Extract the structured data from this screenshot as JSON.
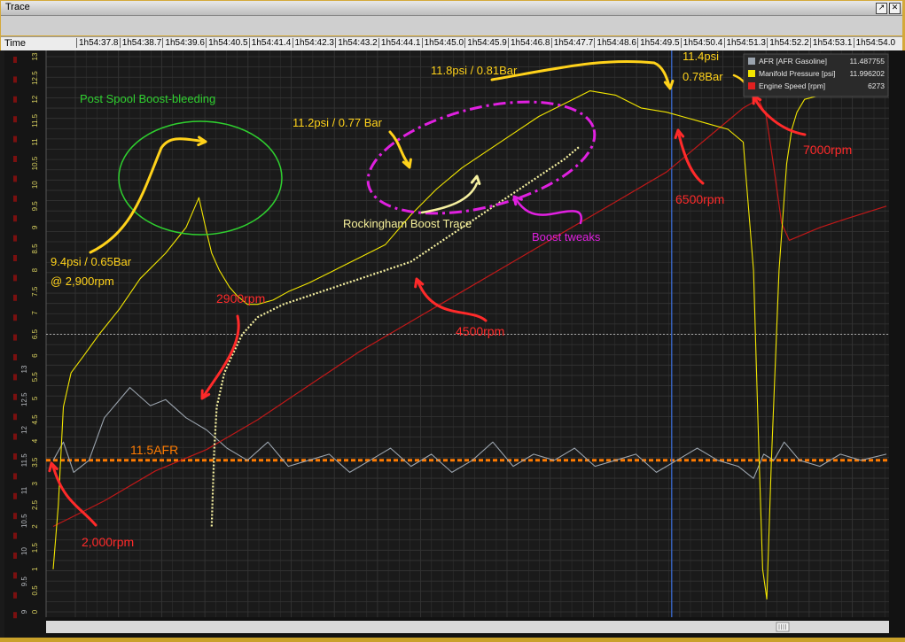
{
  "window": {
    "title": "Trace",
    "time_column_label": "Time"
  },
  "time_ticks": [
    "1h54:37.8",
    "1h54:38.7",
    "1h54:39.6",
    "1h54:40.5",
    "1h54:41.4",
    "1h54:42.3",
    "1h54:43.2",
    "1h54:44.1",
    "1h54:45.0",
    "1h54:45.9",
    "1h54:46.8",
    "1h54:47.7",
    "1h54:48.6",
    "1h54:49.5",
    "1h54:50.4",
    "1h54:51.3",
    "1h54:52.2",
    "1h54:53.1",
    "1h54:54.0"
  ],
  "legend": [
    {
      "label": "AFR [AFR Gasoline]",
      "value": "11.487755",
      "color": "#9aa3ad"
    },
    {
      "label": "Manifold Pressure [psi]",
      "value": "11.996202",
      "color": "#f2e600"
    },
    {
      "label": "Engine Speed [rpm]",
      "value": "6273",
      "color": "#e02020"
    }
  ],
  "annotations": {
    "post_spool": "Post Spool Boost-bleeding",
    "psi_94": "9.4psi / 0.65Bar",
    "at_2900": "@ 2,900rpm",
    "psi_112": "11.2psi / 0.77 Bar",
    "psi_118": "11.8psi / 0.81Bar",
    "psi_114_a": "11.4psi",
    "psi_114_b": "0.78Bar",
    "rockingham": "Rockingham Boost Trace",
    "boost_tweaks": "Boost tweaks",
    "rpm_2900": "2900rpm",
    "rpm_4500": "4500rpm",
    "rpm_6500": "6500rpm",
    "rpm_7000": "7000rpm",
    "rpm_2000": "2,000rpm",
    "afr_line": "11.5AFR"
  },
  "colors": {
    "background": "#1a1a1a",
    "grid": "#343434",
    "afr": "#9aa3ad",
    "boost": "#f2e600",
    "rpm": "#c01818",
    "annotation_red": "#ff2a2a",
    "annotation_yellow": "#ffd21a",
    "annotation_green": "#2fd02f",
    "annotation_magenta": "#e020e0",
    "afr_reference": "#ff7b00",
    "cursor": "#3a6ad0"
  },
  "chart_data": {
    "type": "line",
    "x_unit": "seconds elapsed",
    "xlim": [
      0,
      16.3
    ],
    "y_ticks_afr": [
      "13",
      "12.5",
      "12",
      "11.5",
      "11",
      "10.5",
      "10",
      "9.5",
      "9"
    ],
    "y_ticks_boost": [
      "13",
      "12.5",
      "12",
      "11.5",
      "11",
      "10.5",
      "10",
      "9.5",
      "9",
      "8.5",
      "8",
      "7.5",
      "7",
      "6.5",
      "6",
      "5.5",
      "5",
      "4.5",
      "4",
      "3.5",
      "3",
      "2.5",
      "2",
      "1.5",
      "1",
      "0.5",
      "0"
    ],
    "series": [
      {
        "name": "Manifold Pressure [psi]",
        "ylim": [
          0,
          13
        ],
        "x": [
          0.0,
          0.1,
          0.2,
          0.35,
          0.6,
          0.9,
          1.3,
          1.7,
          2.2,
          2.6,
          2.85,
          3.0,
          3.1,
          3.25,
          3.45,
          3.6,
          3.8,
          4.0,
          4.3,
          4.6,
          5.0,
          5.5,
          6.0,
          6.5,
          7.0,
          7.5,
          8.0,
          8.5,
          9.0,
          9.5,
          10.0,
          10.5,
          11.0,
          11.5,
          12.0,
          12.3,
          12.6,
          12.9,
          13.2,
          13.5,
          13.7,
          13.8,
          13.88,
          13.96,
          14.05,
          14.2,
          14.35,
          14.45,
          14.55,
          14.7,
          16.3
        ],
        "values": [
          1.0,
          2.5,
          4.8,
          5.6,
          6.0,
          6.5,
          7.1,
          7.8,
          8.4,
          9.0,
          9.7,
          8.9,
          8.4,
          8.0,
          7.6,
          7.4,
          7.2,
          7.2,
          7.3,
          7.5,
          7.7,
          8.0,
          8.3,
          8.6,
          9.3,
          9.9,
          10.4,
          10.8,
          11.2,
          11.6,
          11.9,
          12.2,
          12.1,
          11.8,
          11.7,
          11.6,
          11.5,
          11.4,
          11.3,
          11.0,
          8.0,
          4.0,
          1.0,
          0.3,
          3.5,
          8.0,
          10.5,
          11.3,
          11.7,
          12.0,
          12.5
        ]
      },
      {
        "name": "Rockingham Boost Trace",
        "ylim": [
          0,
          13
        ],
        "x": [
          3.1,
          3.15,
          3.2,
          3.35,
          3.5,
          3.7,
          4.0,
          4.5,
          5.0,
          5.5,
          6.0,
          6.5,
          7.0,
          7.5,
          8.0,
          8.5,
          9.0,
          9.5,
          10.0,
          10.3
        ],
        "values": [
          2.0,
          3.8,
          4.8,
          5.6,
          6.0,
          6.5,
          6.9,
          7.2,
          7.4,
          7.6,
          7.8,
          8.0,
          8.2,
          8.6,
          9.0,
          9.4,
          9.8,
          10.2,
          10.6,
          10.9
        ]
      },
      {
        "name": "Engine Speed [rpm]",
        "ylim": [
          1000,
          7500
        ],
        "x": [
          0.0,
          0.5,
          1.0,
          2.0,
          3.0,
          4.0,
          5.0,
          6.0,
          7.0,
          8.0,
          9.0,
          10.0,
          11.0,
          12.0,
          12.5,
          13.0,
          13.5,
          13.8,
          13.95,
          14.1,
          14.25,
          14.4,
          14.6,
          14.8,
          15.0,
          15.5,
          16.3
        ],
        "values": [
          2000,
          2150,
          2300,
          2650,
          2900,
          3250,
          3650,
          4050,
          4400,
          4750,
          5100,
          5450,
          5800,
          6150,
          6400,
          6650,
          6900,
          7000,
          6800,
          6200,
          5550,
          5350,
          5400,
          5450,
          5500,
          5600,
          5750
        ]
      },
      {
        "name": "AFR [AFR Gasoline]",
        "ylim": [
          9,
          13
        ],
        "x": [
          0.0,
          0.2,
          0.4,
          0.7,
          1.0,
          1.5,
          1.9,
          2.2,
          2.6,
          3.0,
          3.4,
          3.8,
          4.2,
          4.6,
          5.0,
          5.4,
          5.8,
          6.2,
          6.6,
          7.0,
          7.4,
          7.8,
          8.2,
          8.6,
          9.0,
          9.4,
          9.8,
          10.2,
          10.6,
          11.0,
          11.4,
          11.8,
          12.2,
          12.6,
          13.0,
          13.4,
          13.7,
          13.9,
          14.1,
          14.3,
          14.6,
          15.0,
          15.4,
          15.8,
          16.3
        ],
        "values": [
          11.5,
          11.8,
          11.3,
          11.5,
          12.2,
          12.7,
          12.4,
          12.5,
          12.2,
          12.0,
          11.7,
          11.5,
          11.8,
          11.4,
          11.5,
          11.6,
          11.3,
          11.5,
          11.7,
          11.4,
          11.6,
          11.3,
          11.5,
          11.8,
          11.4,
          11.6,
          11.5,
          11.7,
          11.4,
          11.5,
          11.6,
          11.3,
          11.5,
          11.7,
          11.5,
          11.4,
          11.2,
          11.6,
          11.5,
          11.8,
          11.5,
          11.4,
          11.6,
          11.5,
          11.6
        ]
      }
    ],
    "reference_lines": [
      {
        "label": "11.5AFR",
        "axis": "afr",
        "value": 11.5
      },
      {
        "axis": "boost",
        "value": 6.5
      }
    ],
    "cursor_x": 12.1,
    "grid": true,
    "legend_position": "top-right"
  }
}
